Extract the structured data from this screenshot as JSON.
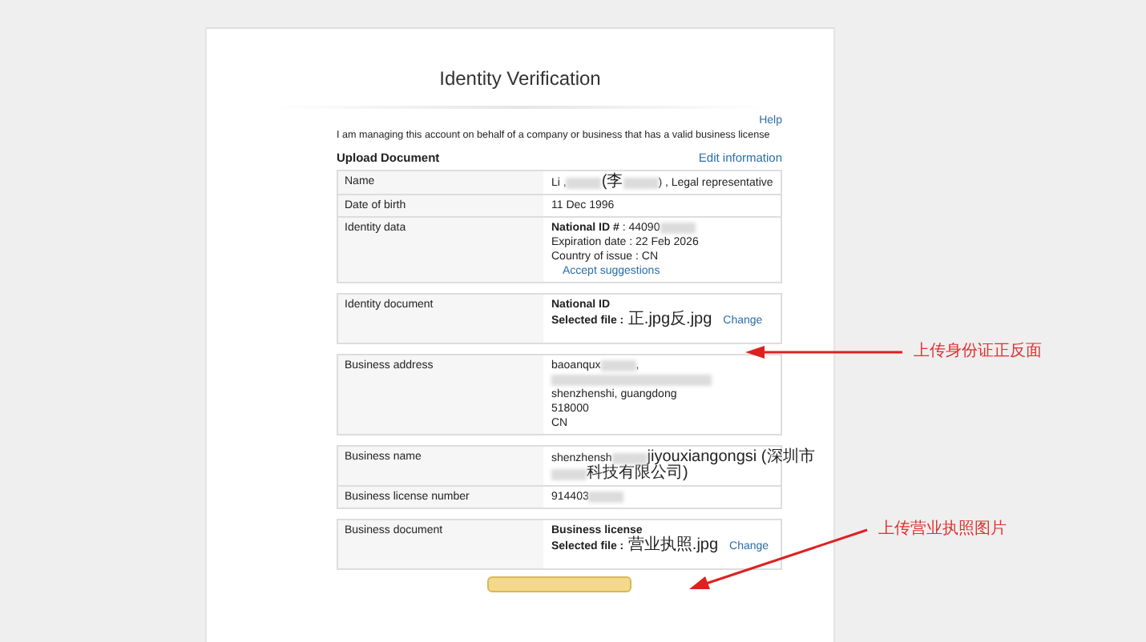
{
  "page": {
    "title": "Identity Verification",
    "help_link": "Help",
    "statement": "I am managing this account on behalf of a company or business that has a valid business license",
    "section_title": "Upload Document",
    "edit_link": "Edit information"
  },
  "groups": [
    {
      "rows": [
        {
          "label": "Name",
          "lines": [
            [
              {
                "kind": "text",
                "text": "Li ,"
              },
              {
                "kind": "redacted"
              },
              {
                "kind": "text",
                "text": "(李"
              },
              {
                "kind": "redacted"
              },
              {
                "kind": "text",
                "text": ") , Legal representative"
              }
            ]
          ]
        },
        {
          "label": "Date of birth",
          "lines": [
            [
              {
                "kind": "text",
                "text": "11 Dec 1996"
              }
            ]
          ]
        },
        {
          "label": "Identity data",
          "lines": [
            [
              {
                "kind": "bold",
                "text": "National ID #"
              },
              {
                "kind": "text",
                "text": " : 44090"
              },
              {
                "kind": "redacted"
              }
            ],
            [
              {
                "kind": "text",
                "text": "Expiration date : 22 Feb 2026"
              }
            ],
            [
              {
                "kind": "text",
                "text": "Country of issue : CN"
              }
            ],
            [
              {
                "kind": "link",
                "text": "Accept suggestions"
              }
            ]
          ]
        }
      ]
    },
    {
      "rows": [
        {
          "label": "Identity document",
          "lines": [
            [
              {
                "kind": "bold",
                "text": "National ID"
              }
            ],
            [
              {
                "kind": "bold",
                "text": "Selected file :"
              },
              {
                "kind": "text",
                "text": " 正.jpg反.jpg"
              },
              {
                "kind": "link",
                "text": "Change"
              }
            ]
          ]
        }
      ]
    },
    {
      "rows": [
        {
          "label": "Business address",
          "lines": [
            [
              {
                "kind": "text",
                "text": "baoanqux"
              },
              {
                "kind": "redacted"
              },
              {
                "kind": "text",
                "text": ","
              }
            ],
            [
              {
                "kind": "redacted"
              }
            ],
            [
              {
                "kind": "text",
                "text": "shenzhenshi, guangdong"
              }
            ],
            [
              {
                "kind": "text",
                "text": "518000"
              }
            ],
            [
              {
                "kind": "text",
                "text": "CN"
              }
            ]
          ]
        }
      ]
    },
    {
      "rows": [
        {
          "label": "Business name",
          "lines": [
            [
              {
                "kind": "text",
                "text": "shenzhensh"
              },
              {
                "kind": "redacted"
              },
              {
                "kind": "text",
                "text": "jiyouxiangongsi (深圳市"
              }
            ],
            [
              {
                "kind": "redacted"
              },
              {
                "kind": "text",
                "text": "科技有限公司)"
              }
            ]
          ]
        },
        {
          "label": "Business license number",
          "lines": [
            [
              {
                "kind": "text",
                "text": "914403"
              },
              {
                "kind": "redacted"
              }
            ]
          ]
        }
      ]
    },
    {
      "rows": [
        {
          "label": "Business document",
          "lines": [
            [
              {
                "kind": "bold",
                "text": "Business license"
              }
            ],
            [
              {
                "kind": "bold",
                "text": "Selected file :"
              },
              {
                "kind": "text",
                "text": " 营业执照.jpg"
              },
              {
                "kind": "link",
                "text": "Change"
              }
            ]
          ]
        }
      ]
    }
  ],
  "annotations": [
    {
      "text": "上传身份证正反面"
    },
    {
      "text": "上传营业执照图片"
    }
  ]
}
